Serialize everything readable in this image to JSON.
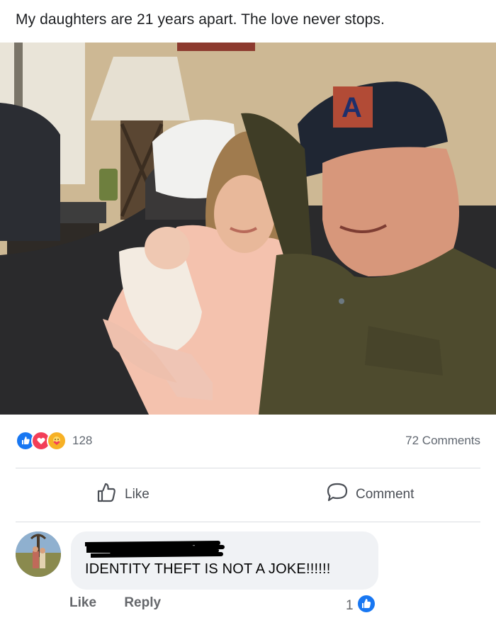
{
  "post": {
    "caption": "My daughters are 21 years apart. The love never stops."
  },
  "stats": {
    "reaction_icons": [
      "like-icon",
      "love-icon",
      "care-icon"
    ],
    "reaction_count": "128",
    "comments_count": "72 Comments"
  },
  "actions": {
    "like_label": "Like",
    "comment_label": "Comment"
  },
  "comment": {
    "text": "IDENTITY THEFT IS NOT A JOKE!!!!!!",
    "like_label": "Like",
    "reply_label": "Reply",
    "reaction_count": "1"
  },
  "colors": {
    "facebook_blue": "#1877f2",
    "love_red": "#f33e58",
    "care_yellow": "#f7b125",
    "muted_text": "#65676b"
  }
}
